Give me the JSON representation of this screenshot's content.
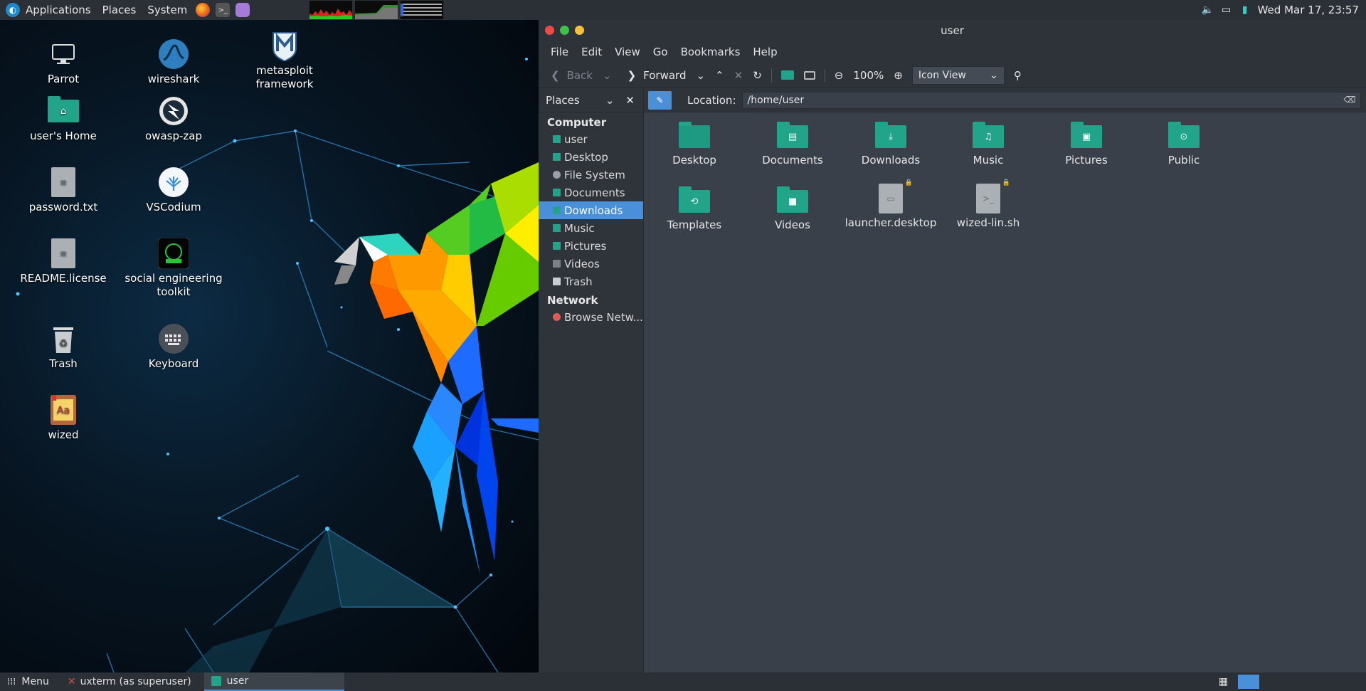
{
  "top_panel": {
    "applications": "Applications",
    "places": "Places",
    "system": "System",
    "clock": "Wed Mar 17, 23:57"
  },
  "desktop": {
    "icons": [
      {
        "label": "Parrot",
        "icon": "computer-icon"
      },
      {
        "label": "wireshark",
        "icon": "wireshark-icon"
      },
      {
        "label": "metasploit framework",
        "icon": "metasploit-icon"
      },
      {
        "label": "user's Home",
        "icon": "home-folder-icon"
      },
      {
        "label": "owasp-zap",
        "icon": "zap-icon"
      },
      {
        "label": "password.txt",
        "icon": "text-file-icon"
      },
      {
        "label": "VSCodium",
        "icon": "vscodium-icon"
      },
      {
        "label": "README.license",
        "icon": "text-file-icon"
      },
      {
        "label": "social engineering toolkit",
        "icon": "set-icon"
      },
      {
        "label": "Trash",
        "icon": "trash-icon"
      },
      {
        "label": "Keyboard",
        "icon": "keyboard-icon"
      },
      {
        "label": "wized",
        "icon": "font-icon"
      }
    ]
  },
  "window": {
    "title": "user",
    "menu": [
      "File",
      "Edit",
      "View",
      "Go",
      "Bookmarks",
      "Help"
    ],
    "toolbar": {
      "back": "Back",
      "forward": "Forward",
      "zoom": "100%",
      "view_mode": "Icon View"
    },
    "sidebar": {
      "header": "Places",
      "sections": [
        {
          "title": "Computer",
          "items": [
            "user",
            "Desktop",
            "File System",
            "Documents",
            "Downloads",
            "Music",
            "Pictures",
            "Videos",
            "Trash"
          ]
        },
        {
          "title": "Network",
          "items": [
            "Browse Netw..."
          ]
        }
      ],
      "selected": "Downloads"
    },
    "location": {
      "label": "Location:",
      "path": "/home/user"
    },
    "files": [
      {
        "name": "Desktop",
        "type": "folder-desktop"
      },
      {
        "name": "Documents",
        "type": "folder-documents"
      },
      {
        "name": "Downloads",
        "type": "folder-downloads"
      },
      {
        "name": "Music",
        "type": "folder-music"
      },
      {
        "name": "Pictures",
        "type": "folder-pictures"
      },
      {
        "name": "Public",
        "type": "folder-public"
      },
      {
        "name": "Templates",
        "type": "folder-templates"
      },
      {
        "name": "Videos",
        "type": "folder-videos"
      },
      {
        "name": "launcher.desktop",
        "type": "file-locked"
      },
      {
        "name": "wized-lin.sh",
        "type": "script-locked"
      }
    ]
  },
  "bottom_panel": {
    "menu": "Menu",
    "tasks": [
      "uxterm (as superuser)",
      "user"
    ]
  },
  "colors": {
    "accent": "#4a90d9",
    "folder": "#22a48a",
    "panel": "#2b2f36"
  }
}
